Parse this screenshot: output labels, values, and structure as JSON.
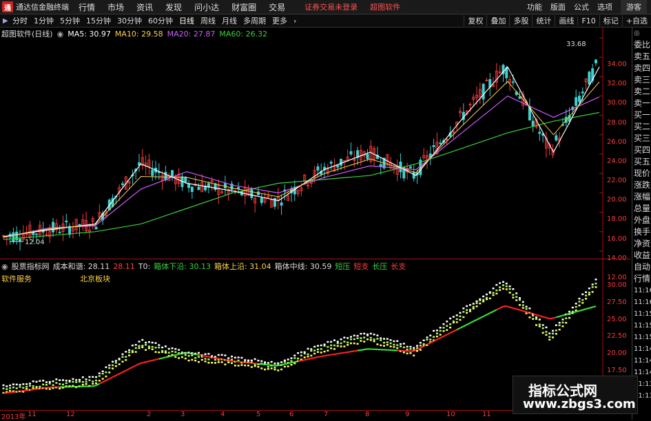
{
  "menubar": {
    "logo": "通",
    "app_title": "通达信金融终端",
    "items": [
      "行情",
      "市场",
      "资讯",
      "发现",
      "问小达",
      "财富圈",
      "交易"
    ],
    "warning": "证券交易未登录",
    "brand": "超图软件",
    "right_items": [
      "功能",
      "版面",
      "公式",
      "选项"
    ],
    "guest": "游客"
  },
  "toolbar": {
    "periods": [
      "分时",
      "1分钟",
      "5分钟",
      "15分钟",
      "30分钟",
      "60分钟",
      "日线",
      "周线",
      "月线",
      "多周期",
      "更多"
    ],
    "active_period": "日线",
    "tools": [
      "复权",
      "叠加",
      "多股",
      "统计",
      "画线",
      "F10",
      "标记",
      "+自选"
    ]
  },
  "price_panel": {
    "title": "超图软件(日线)",
    "ma": [
      {
        "label": "MA5: 30.97",
        "color": "#ffffff"
      },
      {
        "label": "MA10: 29.58",
        "color": "#ffd24a"
      },
      {
        "label": "MA20: 27.87",
        "color": "#d05cff"
      },
      {
        "label": "MA60: 26.32",
        "color": "#39d339"
      }
    ],
    "y_ticks": [
      "34.00",
      "32.00",
      "30.00",
      "28.00",
      "26.00",
      "24.00",
      "22.00",
      "20.00",
      "18.00",
      "16.00",
      "14.00",
      "12.00"
    ],
    "high_label": "33.68",
    "low_label": "12.04"
  },
  "indicator_panel": {
    "source": "股票指标网",
    "cost_label": "成本和谐: 28.11",
    "value2": "28.11",
    "t0_label": "T0:",
    "lower": "箱体下沿: 30.13",
    "upper": "箱体上沿: 31.04",
    "middle": "箱体中线: 30.59",
    "legend": [
      {
        "label": "短压",
        "color": "#39d339"
      },
      {
        "label": "短支",
        "color": "#ff4040"
      },
      {
        "label": "长压",
        "color": "#39d339"
      },
      {
        "label": "长支",
        "color": "#ff4040"
      }
    ],
    "sub_left": "软件服务",
    "sub_right": "北京板块",
    "y_ticks": [
      "30.00",
      "27.50",
      "25.00",
      "22.50",
      "20.00",
      "17.50"
    ]
  },
  "x_axis": {
    "labels": [
      "2013年",
      "11",
      "12",
      "2",
      "3",
      "4",
      "5",
      "6",
      "7",
      "8",
      "9",
      "10",
      "11"
    ],
    "bottom_tag": "周期转"
  },
  "right_panel": {
    "top_glyph": "◎",
    "items": [
      "委比",
      "卖五",
      "卖四",
      "卖三",
      "卖二",
      "卖一",
      "买一",
      "买二",
      "买三",
      "买四",
      "买五",
      "现价",
      "涨跌",
      "涨幅",
      "总量",
      "外盘",
      "换手",
      "净资",
      "收益",
      "自动",
      "行情"
    ],
    "times": [
      "11:16",
      "11:16",
      "11:15",
      "11:15",
      "11:15",
      "11:14",
      "11:14",
      "11:14",
      "11:13",
      "11:13"
    ]
  },
  "watermark": {
    "line1": "指标公式网",
    "line2": "www.zbgs3.com"
  },
  "chart_data": {
    "type": "line",
    "x": [
      "2013-10",
      "2013-11",
      "2013-12",
      "2014-01",
      "2014-02",
      "2014-03",
      "2014-04",
      "2014-05",
      "2014-06",
      "2014-07",
      "2014-08",
      "2014-09",
      "2014-10",
      "2014-11"
    ],
    "series": [
      {
        "name": "MA60",
        "values": [
          13.2,
          13.6,
          14.0,
          14.8,
          16.4,
          18.0,
          19.0,
          19.4,
          19.8,
          21.0,
          22.6,
          24.2,
          25.4,
          26.3
        ]
      },
      {
        "name": "MA20",
        "values": [
          13.4,
          14.4,
          14.6,
          18.4,
          20.2,
          18.8,
          18.0,
          19.6,
          20.8,
          20.4,
          24.2,
          28.0,
          25.8,
          27.9
        ]
      },
      {
        "name": "MA5",
        "values": [
          13.5,
          14.2,
          14.8,
          21.0,
          19.0,
          18.2,
          17.2,
          20.4,
          22.2,
          19.8,
          25.6,
          31.0,
          22.2,
          31.0
        ]
      }
    ],
    "ylim": [
      12,
      34
    ]
  }
}
